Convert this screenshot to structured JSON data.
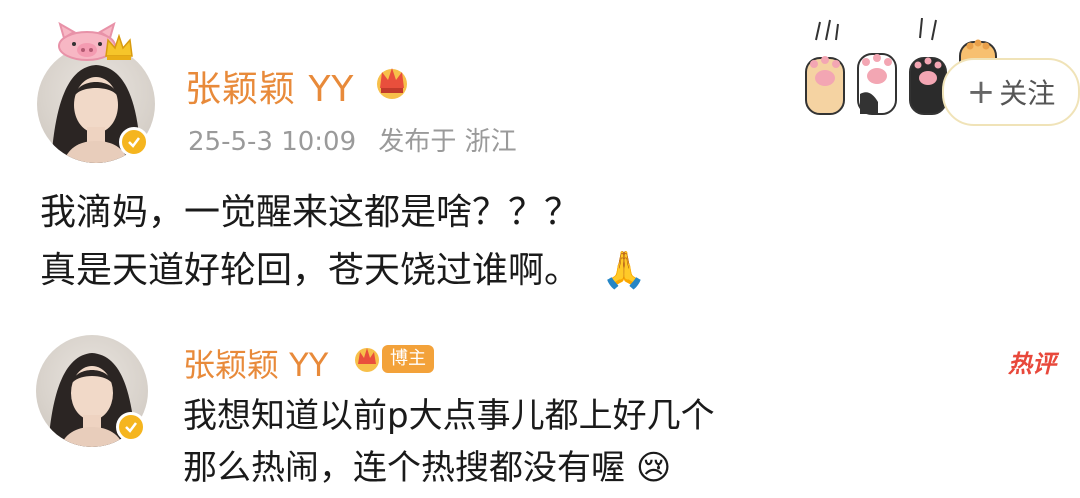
{
  "post": {
    "username": "张颖颖 YY",
    "timestamp": "25-5-3 10:09",
    "published_at": "发布于 浙江",
    "line1": "我滴妈，一觉醒来这都是啥？？？",
    "line2": "真是天道好轮回，苍天饶过谁啊。",
    "follow_label": "关注",
    "emoji_pray": "🙏"
  },
  "comment": {
    "username": "张颖颖 YY",
    "badge": "博主",
    "hot_label": "热评",
    "line1": "我想知道以前p大点事儿都上好几个",
    "line2": "那么热闹，连个热搜都没有喔",
    "emoji": "😢"
  },
  "colors": {
    "username": "#e88a3a",
    "meta": "#9a9a9a",
    "verified": "#f5b51f",
    "hot": "#e8483b"
  },
  "icons": [
    "pig-hat-icon",
    "crown-icon",
    "verified-badge-icon",
    "cat-paw-icon",
    "plus-icon",
    "pray-emoji",
    "sad-emoji"
  ]
}
